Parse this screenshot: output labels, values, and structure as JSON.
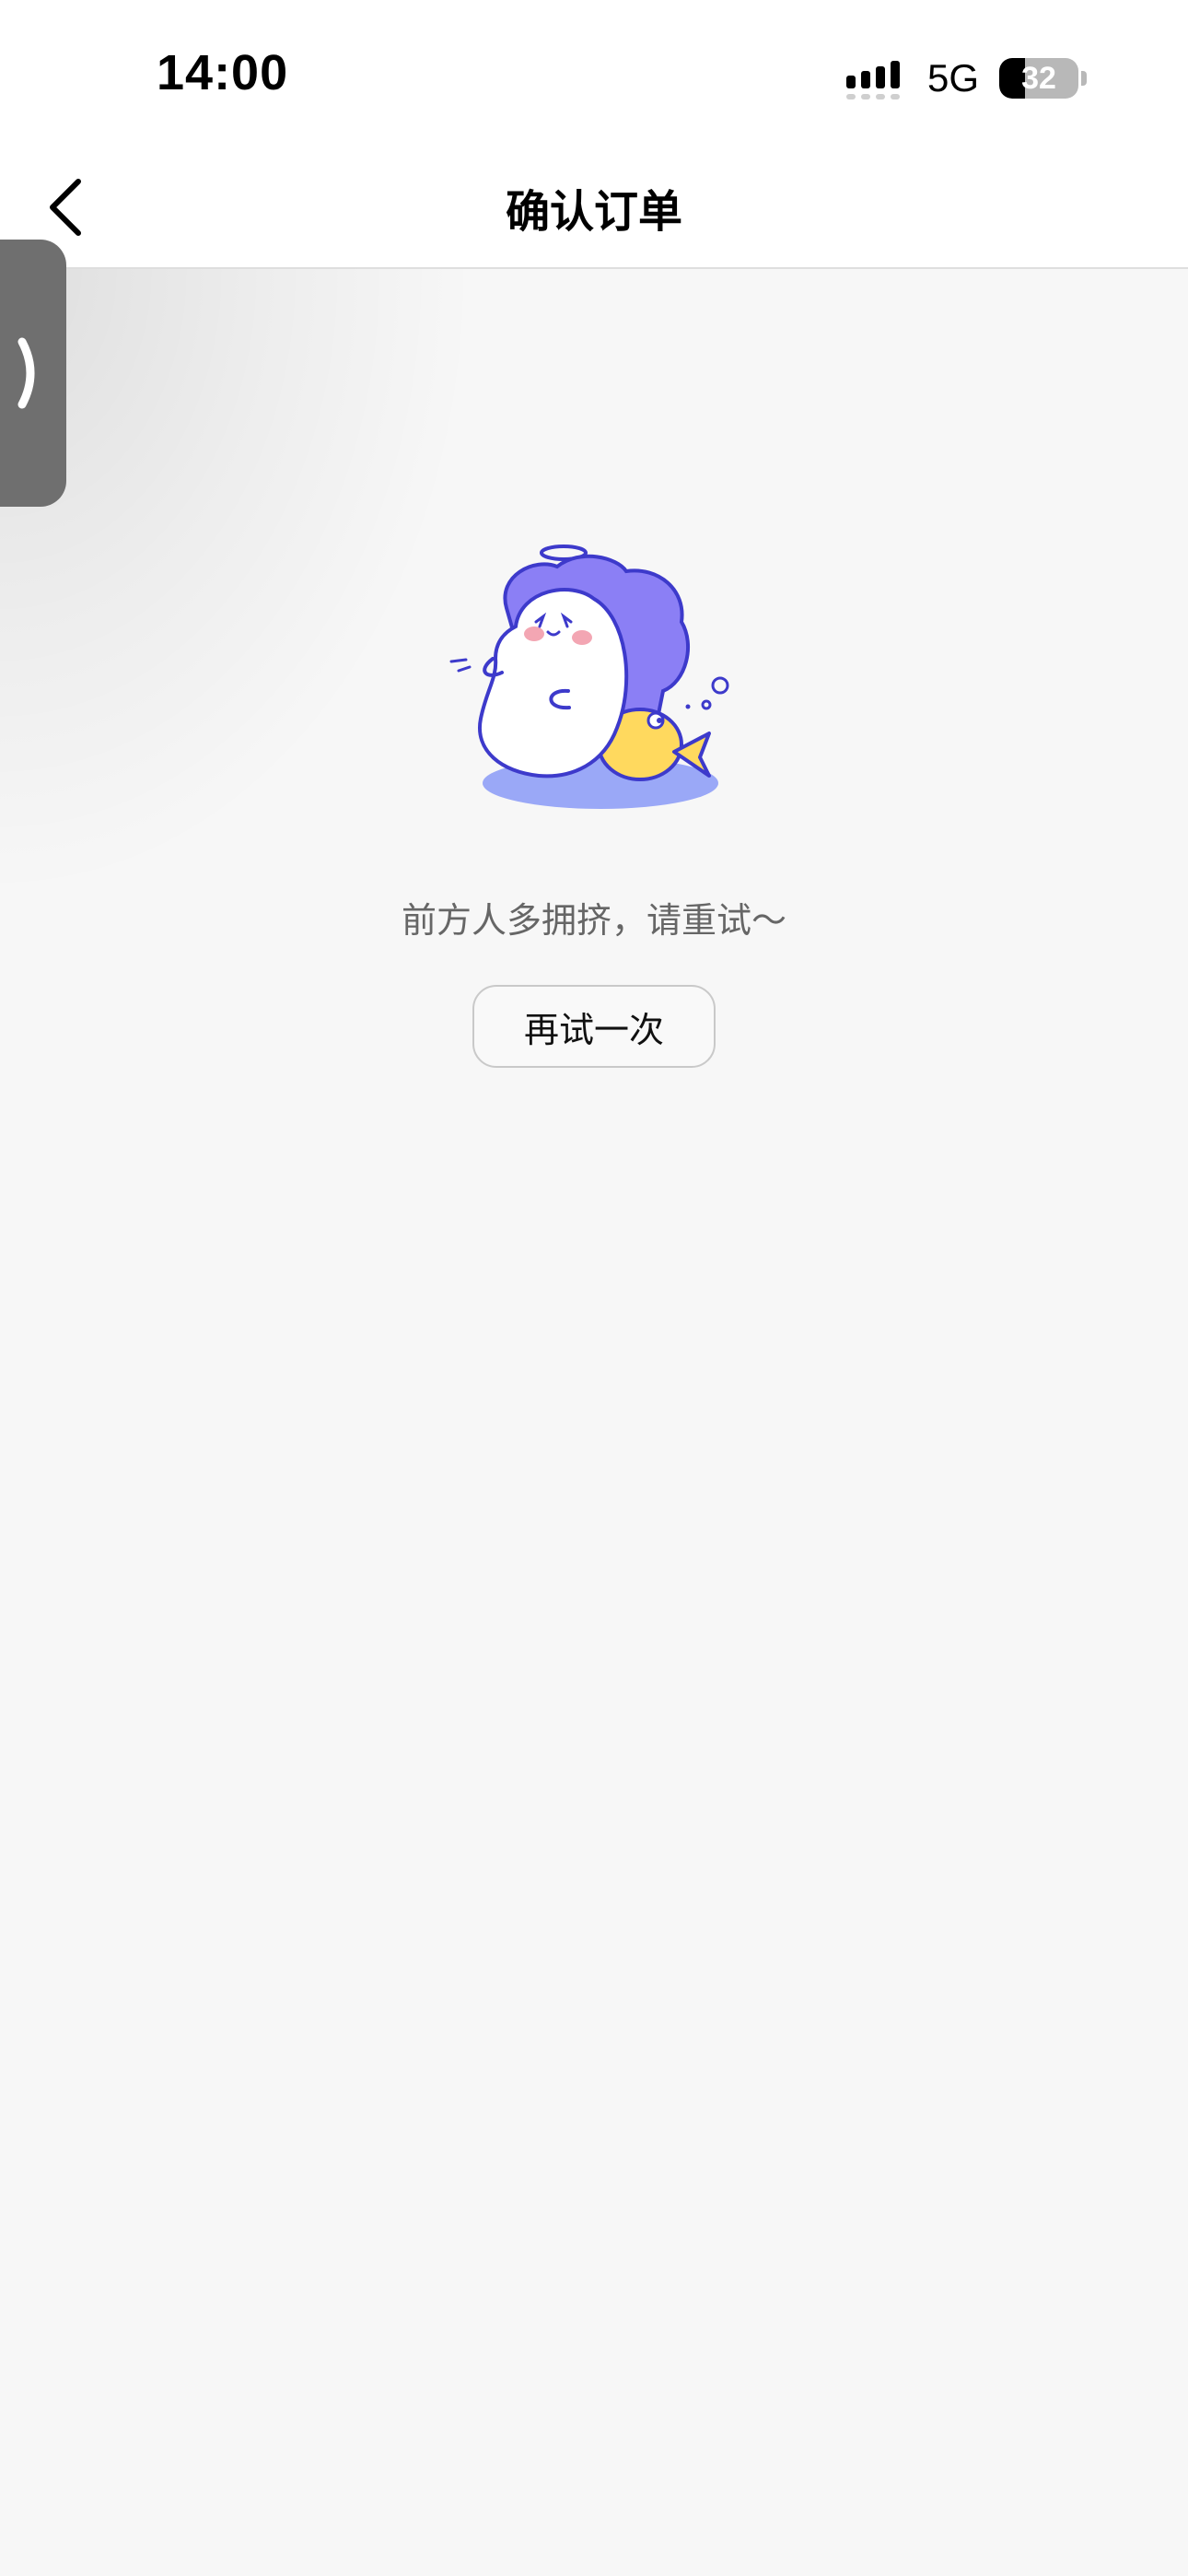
{
  "status_bar": {
    "time": "14:00",
    "network": "5G",
    "battery": "32",
    "battery_level": 0.32
  },
  "nav": {
    "title": "确认订单",
    "back_icon": "chevron-left-icon"
  },
  "side_tab": {
    "icon": "chevron-right-icon"
  },
  "error": {
    "illustration": "busy-mascot-illustration",
    "message": "前方人多拥挤，请重试～",
    "retry_label": "再试一次"
  },
  "colors": {
    "background": "#f7f7f7",
    "mascot_purple": "#8b7ff5",
    "mascot_outline": "#3d3acb",
    "fish_yellow": "#ffd95e",
    "shadow_blue": "#9aa8f7"
  }
}
